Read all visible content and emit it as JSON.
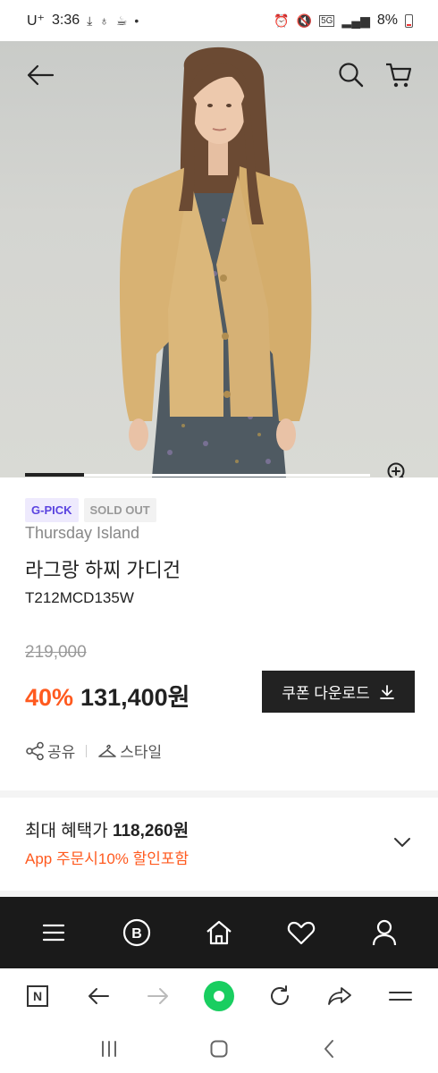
{
  "status_bar": {
    "carrier": "U⁺",
    "time": "3:36",
    "battery": "8%"
  },
  "hero": {
    "slider_progress": 0.17
  },
  "product": {
    "badges": [
      "G-PICK",
      "SOLD OUT"
    ],
    "brand": "Thursday Island",
    "name": "라그랑 하찌 가디건",
    "code": "T212MCD135W",
    "original_price": "219,000",
    "discount": "40%",
    "sale_price": "131,400원",
    "coupon_button": "쿠폰 다운로드",
    "share": "공유",
    "style": "스타일"
  },
  "benefit": {
    "label": "최대 혜택가 ",
    "price": "118,260원",
    "sub": "App 주문시10% 할인포함"
  },
  "site_nav": {
    "items": [
      "menu-icon",
      "brand-b-icon",
      "home-icon",
      "heart-icon",
      "person-icon"
    ],
    "brand_letter": "B"
  },
  "browser_bar": {
    "n_label": "N"
  },
  "colors": {
    "accent_orange": "#ff5a1f",
    "gpick_purple": "#5b44e0",
    "nav_dark": "#1a1a1a",
    "naver_green": "#19ce60"
  }
}
